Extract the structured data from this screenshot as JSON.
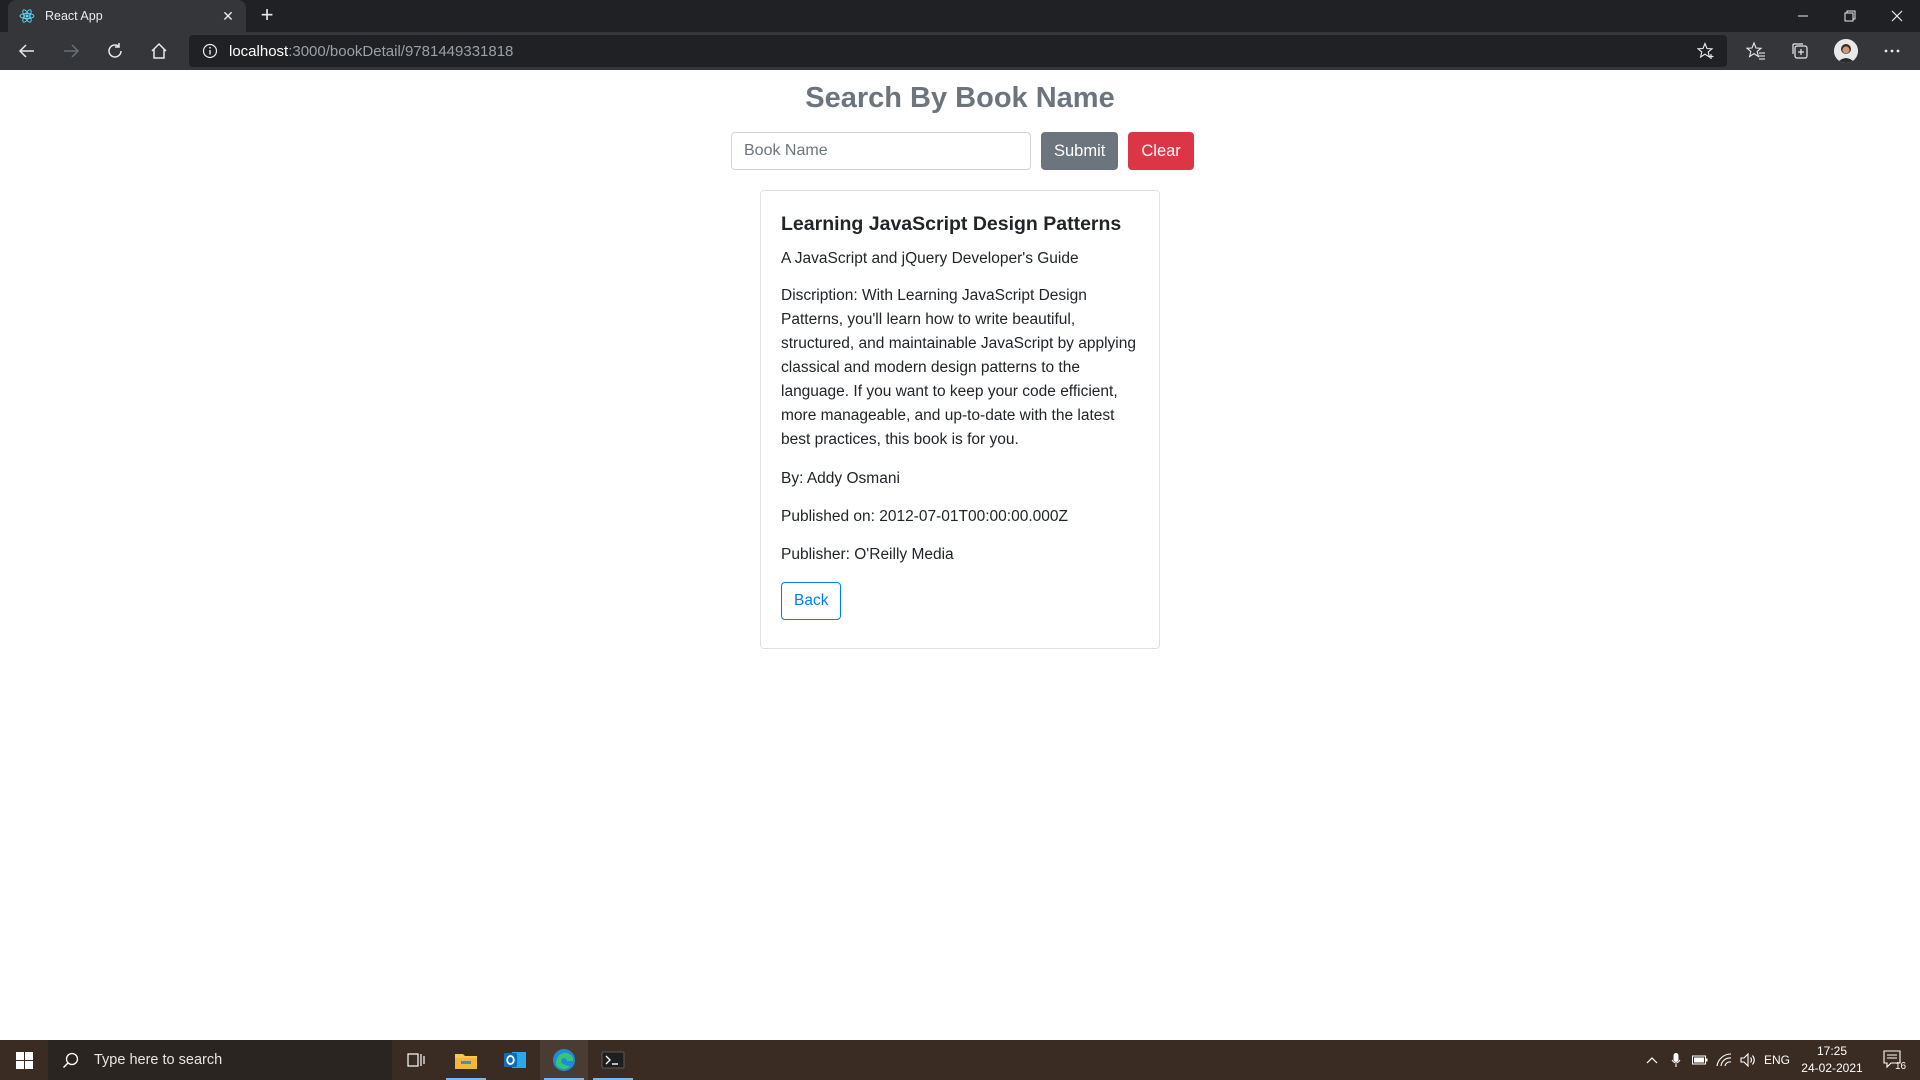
{
  "browser": {
    "tab_title": "React App",
    "url_host": "localhost",
    "url_path": ":3000/bookDetail/9781449331818"
  },
  "page": {
    "title": "Search By Book Name",
    "search": {
      "placeholder": "Book Name",
      "value": "",
      "submit_label": "Submit",
      "clear_label": "Clear"
    },
    "book": {
      "title": "Learning JavaScript Design Patterns",
      "subtitle": "A JavaScript and jQuery Developer's Guide",
      "description": "Discription: With Learning JavaScript Design Patterns, you'll learn how to write beautiful, structured, and maintainable JavaScript by applying classical and modern design patterns to the language. If you want to keep your code efficient, more manageable, and up-to-date with the latest best practices, this book is for you.",
      "author": "By: Addy Osmani",
      "published": "Published on: 2012-07-01T00:00:00.000Z",
      "publisher": "Publisher: O'Reilly Media",
      "back_label": "Back"
    }
  },
  "taskbar": {
    "search_placeholder": "Type here to search",
    "language": "ENG",
    "time": "17:25",
    "date": "24-02-2021",
    "notification_count": "16"
  },
  "colors": {
    "submit": "#6c757d",
    "clear": "#dc3545",
    "back": "#007bff",
    "title": "#6c757d"
  },
  "icons": [
    "react-icon",
    "close-icon",
    "plus-icon",
    "minimize-icon",
    "restore-icon",
    "back-icon",
    "forward-icon",
    "refresh-icon",
    "home-icon",
    "info-icon",
    "star-add-icon",
    "favorites-icon",
    "collections-icon",
    "profile-icon",
    "more-icon",
    "windows-icon",
    "search-icon",
    "task-view-icon",
    "file-explorer-icon",
    "outlook-icon",
    "edge-icon",
    "terminal-icon",
    "chevron-up-icon",
    "microphone-icon",
    "battery-icon",
    "wifi-icon",
    "volume-icon",
    "notification-icon"
  ]
}
